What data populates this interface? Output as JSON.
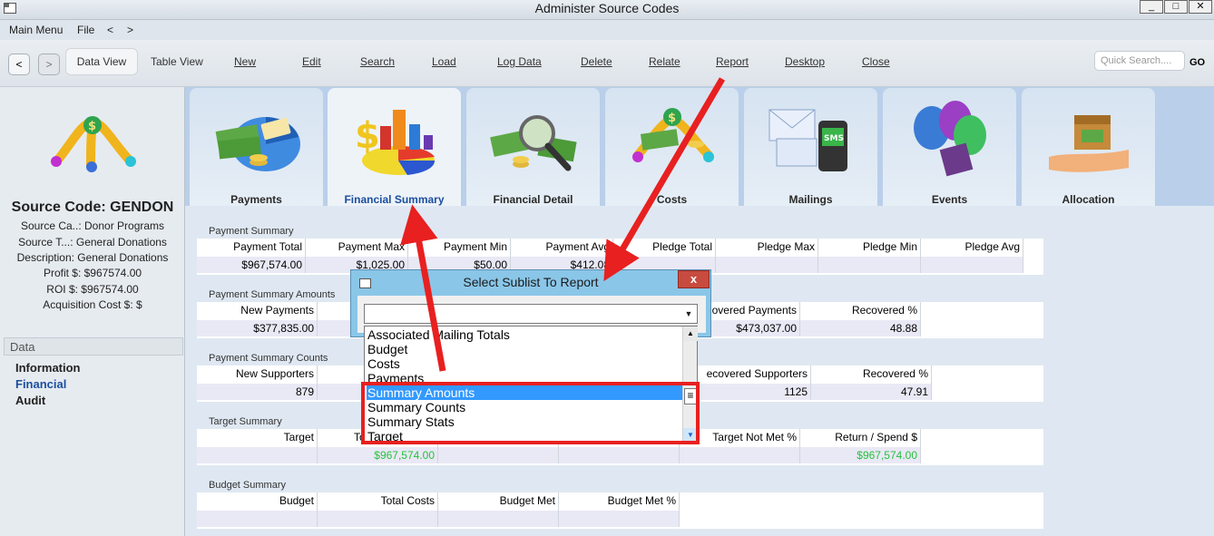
{
  "window": {
    "title": "Administer Source Codes",
    "controls": [
      "_",
      "□",
      "✕"
    ]
  },
  "menubar": {
    "items": [
      "Main Menu",
      "File",
      "<",
      ">"
    ]
  },
  "toolbar": {
    "back": "<",
    "forward": ">",
    "buttons": [
      "Data View",
      "Table View",
      "New",
      "Edit",
      "Search",
      "Load",
      "Log Data",
      "Delete",
      "Relate",
      "Report",
      "Desktop",
      "Close"
    ],
    "quick_search_placeholder": "Quick Search....",
    "go": "GO"
  },
  "left": {
    "source_code": "Source Code: GENDON",
    "info": [
      "Source Ca..: Donor Programs",
      "Source T...: General Donations",
      "Description: General Donations",
      "Profit $: $967574.00",
      "ROI $: $967574.00",
      "Acquisition Cost $: $"
    ],
    "data_header": "Data",
    "nav": [
      "Information",
      "Financial",
      "Audit"
    ],
    "selected_nav": "Financial"
  },
  "tabs": {
    "items": [
      "Payments",
      "Financial Summary",
      "Financial Detail",
      "Costs",
      "Mailings",
      "Events",
      "Allocation"
    ],
    "selected": "Financial Summary"
  },
  "sections": {
    "payment_summary": {
      "title": "Payment Summary",
      "headers": [
        "Payment Total",
        "Payment Max",
        "Payment Min",
        "Payment Avg",
        "Pledge Total",
        "Pledge Max",
        "Pledge Min",
        "Pledge Avg"
      ],
      "values": [
        "$967,574.00",
        "$1,025.00",
        "$50.00",
        "$412.08",
        "",
        "",
        "",
        ""
      ]
    },
    "payment_summary_amounts": {
      "title": "Payment Summary Amounts",
      "headers": [
        "New Payments",
        "",
        "",
        "",
        "overed Payments",
        "Recovered %"
      ],
      "values": [
        "$377,835.00",
        "",
        "",
        "",
        "$473,037.00",
        "48.88"
      ]
    },
    "payment_summary_counts": {
      "title": "Payment Summary Counts",
      "headers": [
        "New Supporters",
        "",
        "",
        "",
        "ecovered Supporters",
        "Recovered %"
      ],
      "values": [
        "879",
        "",
        "",
        "",
        "1125",
        "47.91"
      ]
    },
    "target_summary": {
      "title": "Target Summary",
      "headers": [
        "Target",
        "To",
        "",
        "",
        "Target Not Met %",
        "Return / Spend $"
      ],
      "values": [
        "",
        "$967,574.00",
        "",
        "",
        "",
        "$967,574.00"
      ]
    },
    "budget_summary": {
      "title": "Budget Summary",
      "headers": [
        "Budget",
        "Total Costs",
        "Budget Met",
        "Budget Met %"
      ],
      "values": [
        "",
        "",
        "",
        ""
      ]
    }
  },
  "dialog": {
    "title": "Select Sublist To Report",
    "close": "x",
    "combo_value": "",
    "list": [
      "Associated Mailing Totals",
      "Budget",
      "Costs",
      "Payments",
      "Summary Amounts",
      "Summary Counts",
      "Summary Stats",
      "Target"
    ],
    "selected": "Summary Amounts"
  },
  "colors": {
    "selected_tab_text": "#1b4fa0",
    "green_value": "#27c13d",
    "annotation_red": "#e82020",
    "list_selection": "#3399ff"
  }
}
